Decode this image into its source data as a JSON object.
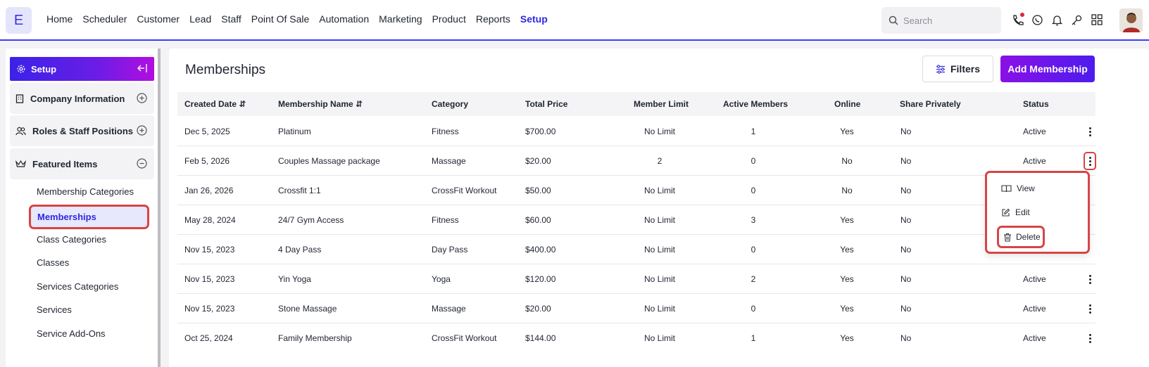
{
  "app": {
    "logo_letter": "E"
  },
  "nav": {
    "items": [
      "Home",
      "Scheduler",
      "Customer",
      "Lead",
      "Staff",
      "Point Of Sale",
      "Automation",
      "Marketing",
      "Product",
      "Reports",
      "Setup"
    ],
    "active": "Setup"
  },
  "search": {
    "placeholder": "Search"
  },
  "sidebar": {
    "header": "Setup",
    "sections": [
      {
        "label": "Company Information",
        "icon": "building-icon",
        "state": "collapsed"
      },
      {
        "label": "Roles & Staff Positions",
        "icon": "users-icon",
        "state": "collapsed"
      },
      {
        "label": "Featured Items",
        "icon": "crown-icon",
        "state": "expanded"
      }
    ],
    "items": [
      "Membership Categories",
      "Memberships",
      "Class Categories",
      "Classes",
      "Services Categories",
      "Services",
      "Service Add-Ons"
    ],
    "active_item": "Memberships"
  },
  "page": {
    "title": "Memberships",
    "filters_label": "Filters",
    "add_label": "Add Membership"
  },
  "table": {
    "columns": [
      "Created Date",
      "Membership Name",
      "Category",
      "Total Price",
      "Member Limit",
      "Active Members",
      "Online",
      "Share Privately",
      "Status"
    ],
    "sortable": [
      "Created Date",
      "Membership Name"
    ],
    "rows": [
      [
        "Dec 5, 2025",
        "Platinum",
        "Fitness",
        "$700.00",
        "No Limit",
        "1",
        "Yes",
        "No",
        "Active"
      ],
      [
        "Feb 5, 2026",
        "Couples Massage package",
        "Massage",
        "$20.00",
        "2",
        "0",
        "No",
        "No",
        "Active"
      ],
      [
        "Jan 26, 2026",
        "Crossfit 1:1",
        "CrossFit Workout",
        "$50.00",
        "No Limit",
        "0",
        "No",
        "No",
        ""
      ],
      [
        "May 28, 2024",
        "24/7 Gym Access",
        "Fitness",
        "$60.00",
        "No Limit",
        "3",
        "Yes",
        "No",
        ""
      ],
      [
        "Nov 15, 2023",
        "4 Day Pass",
        "Day Pass",
        "$400.00",
        "No Limit",
        "0",
        "Yes",
        "No",
        ""
      ],
      [
        "Nov 15, 2023",
        "Yin Yoga",
        "Yoga",
        "$120.00",
        "No Limit",
        "2",
        "Yes",
        "No",
        "Active"
      ],
      [
        "Nov 15, 2023",
        "Stone Massage",
        "Massage",
        "$20.00",
        "No Limit",
        "0",
        "Yes",
        "No",
        "Active"
      ],
      [
        "Oct 25, 2024",
        "Family Membership",
        "CrossFit Workout",
        "$144.00",
        "No Limit",
        "1",
        "Yes",
        "No",
        "Active"
      ]
    ]
  },
  "row_menu": {
    "items": [
      {
        "label": "View",
        "icon": "book-open-icon"
      },
      {
        "label": "Edit",
        "icon": "edit-icon"
      },
      {
        "label": "Delete",
        "icon": "trash-icon"
      }
    ]
  },
  "colors": {
    "accent": "#2e28e0",
    "highlight": "#d64545",
    "gradient_start": "#3b22e8",
    "gradient_end": "#b10ee0"
  }
}
